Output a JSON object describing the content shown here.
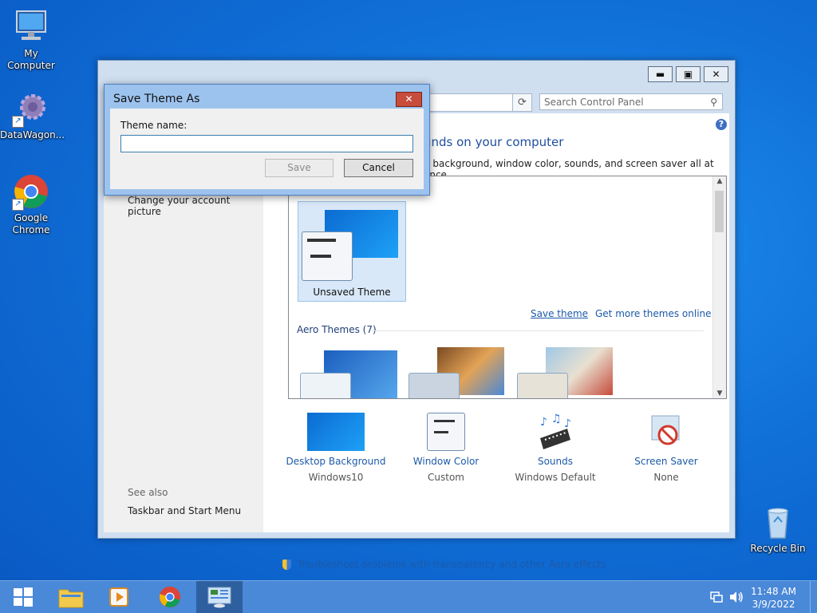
{
  "desktop": {
    "icons": [
      {
        "label": "My Computer"
      },
      {
        "label": "DataWagon..."
      },
      {
        "label": "Google Chrome"
      },
      {
        "label": "Recycle Bin"
      }
    ]
  },
  "control_panel": {
    "search_placeholder": "Search Control Panel",
    "heading": "unds on your computer",
    "subheading": "p background, window color, sounds, and screen saver all at once.",
    "left_links": {
      "account_picture": "Change your account picture",
      "see_also": "See also",
      "taskbar_link": "Taskbar and Start Menu"
    },
    "themes": {
      "unsaved_label": "Unsaved Theme",
      "save_theme": "Save theme",
      "get_more": "Get more themes online",
      "aero_header": "Aero Themes (7)"
    },
    "bottom": [
      {
        "label": "Desktop Background",
        "sub": "Windows10"
      },
      {
        "label": "Window Color",
        "sub": "Custom"
      },
      {
        "label": "Sounds",
        "sub": "Windows Default"
      },
      {
        "label": "Screen Saver",
        "sub": "None"
      }
    ],
    "troubleshoot": "Troubleshoot problems with transparency and other Aero effects"
  },
  "dialog": {
    "title": "Save Theme As",
    "close": "✕",
    "field_label": "Theme name:",
    "field_value": "",
    "save_button": "Save",
    "cancel_button": "Cancel"
  },
  "taskbar": {
    "time": "11:48 AM",
    "date": "3/9/2022"
  },
  "colors": {
    "desktop": "#1070d8",
    "link": "#1c5aa8",
    "taskbar": "#4a88d8"
  }
}
